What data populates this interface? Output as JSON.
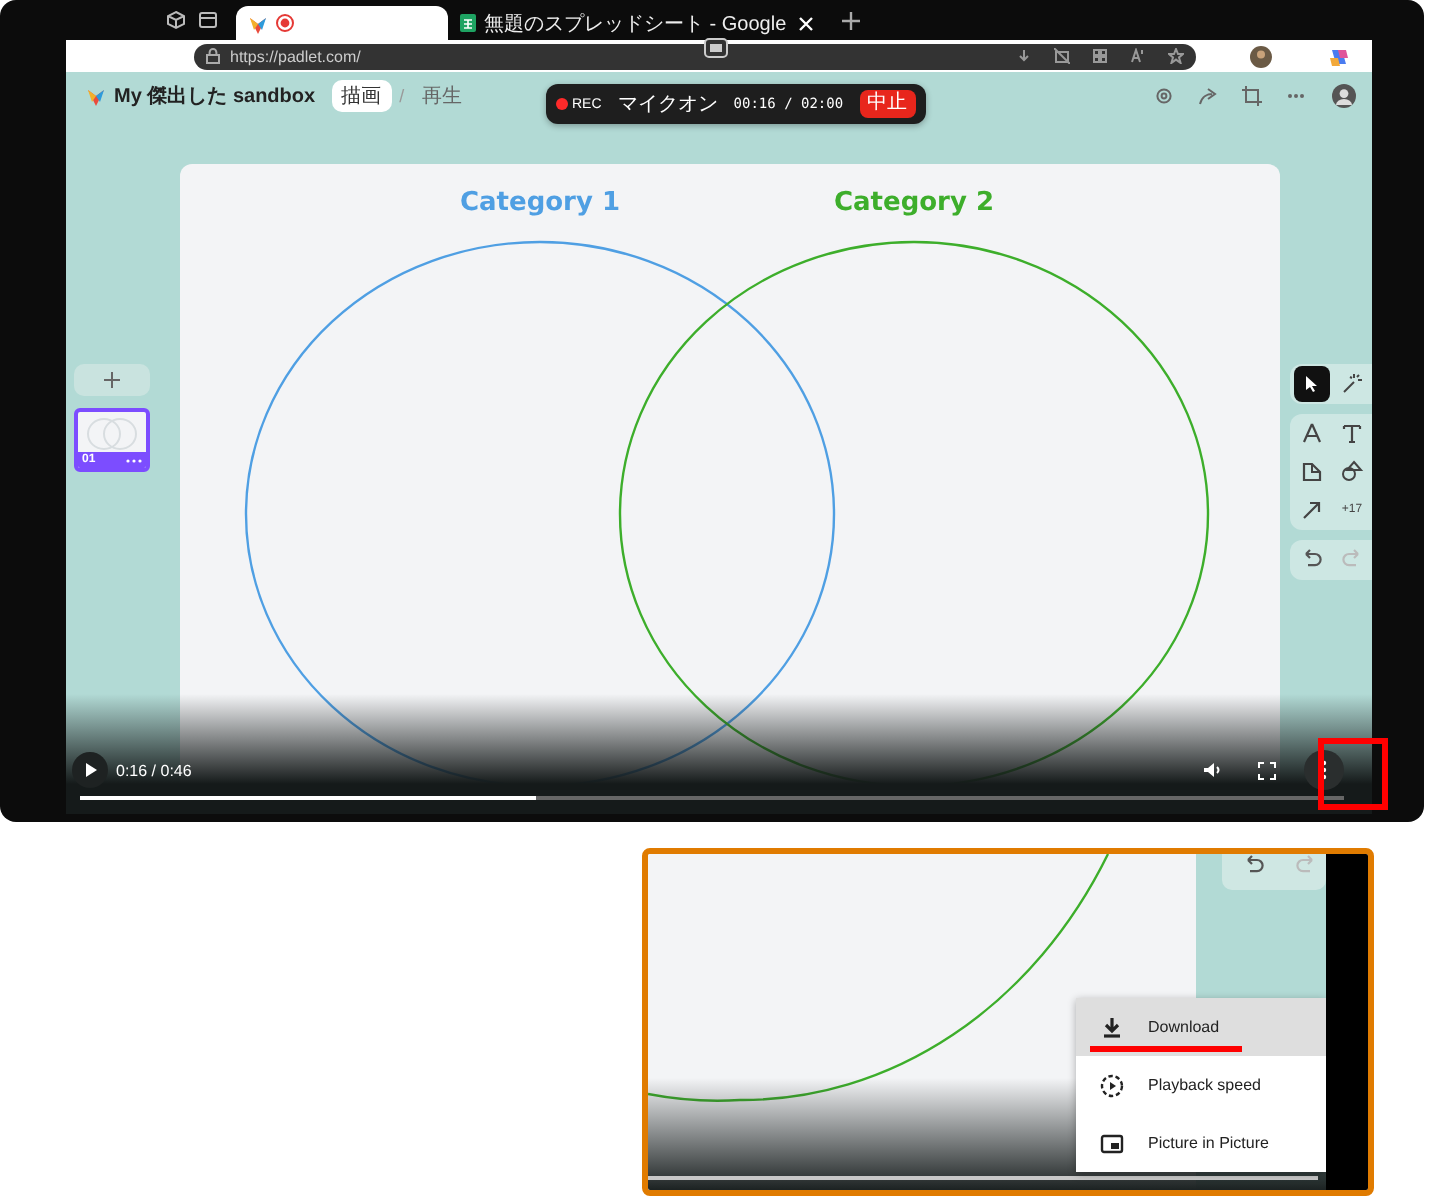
{
  "browser": {
    "tabs": [
      {
        "selected": true,
        "recording": true
      },
      {
        "title": "無題のスプレッドシート - Google",
        "selected": false,
        "recording": false
      }
    ],
    "url": "https://padlet.com/"
  },
  "padlet": {
    "title": "My 傑出した sandbox",
    "modes": [
      {
        "label": "描画",
        "selected": true
      },
      {
        "label": "再生",
        "selected": false
      }
    ],
    "mode_separator": "/",
    "slide": {
      "number": "01",
      "selected": true
    },
    "categories": [
      {
        "label": "Category 1",
        "color": "#4f9fe3"
      },
      {
        "label": "Category 2",
        "color": "#3dae2b"
      }
    ],
    "tool_panels": [
      {
        "tools": [
          {
            "kind": "pointer",
            "selected": true
          },
          {
            "kind": "magic",
            "selected": false
          }
        ]
      },
      {
        "tools": [
          {
            "kind": "pen",
            "selected": false
          },
          {
            "kind": "text",
            "selected": false
          },
          {
            "kind": "note",
            "selected": false
          },
          {
            "kind": "shapes",
            "selected": false
          },
          {
            "kind": "arrow",
            "selected": false
          },
          {
            "kind": "more",
            "label": "+17",
            "selected": false
          }
        ]
      }
    ],
    "history": [
      {
        "kind": "undo",
        "disabled": false
      },
      {
        "kind": "redo",
        "disabled": true
      }
    ]
  },
  "recorder": {
    "rec": "REC",
    "mic": "マイクオン",
    "time": "00:16 / 02:00",
    "stop": "中止"
  },
  "video": {
    "time": "0:16 / 0:46",
    "level": 0.36
  },
  "inset": {
    "history": [
      {
        "kind": "undo",
        "disabled": false
      },
      {
        "kind": "redo",
        "disabled": true
      }
    ],
    "menu": [
      {
        "kind": "download",
        "label": "Download",
        "selected": true
      },
      {
        "kind": "speed",
        "label": "Playback speed",
        "selected": false
      },
      {
        "kind": "pip",
        "label": "Picture in Picture",
        "selected": false
      }
    ]
  }
}
